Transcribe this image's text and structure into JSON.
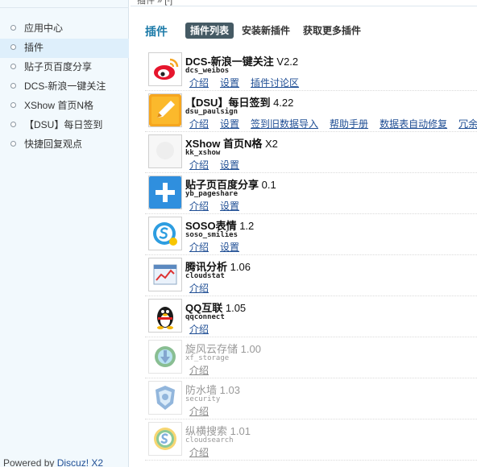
{
  "breadcrumb": "插件 » [-]",
  "sidebar": {
    "items": [
      {
        "label": "应用中心"
      },
      {
        "label": "插件"
      },
      {
        "label": "贴子页百度分享"
      },
      {
        "label": "DCS-新浪一键关注"
      },
      {
        "label": "XShow 首页N格"
      },
      {
        "label": "【DSU】每日签到"
      },
      {
        "label": "快捷回复观点"
      }
    ],
    "active_index": 1,
    "powered_prefix": "Powered by ",
    "powered_brand": "Discuz! X2"
  },
  "header": {
    "title": "插件",
    "tabs": [
      {
        "label": "插件列表",
        "current": true
      },
      {
        "label": "安装新插件",
        "current": false
      },
      {
        "label": "获取更多插件",
        "current": false
      }
    ]
  },
  "plugins": [
    {
      "name": "DCS-新浪一键关注",
      "version": "V2.2",
      "id": "dcs_weibos",
      "icon": "weibo-icon",
      "enabled": true,
      "actions": [
        "介绍",
        "设置",
        "插件讨论区"
      ]
    },
    {
      "name": "【DSU】每日签到",
      "version": "4.22",
      "id": "dsu_paulsign",
      "icon": "pencil-icon",
      "enabled": true,
      "actions": [
        "介绍",
        "设置",
        "签到旧数据导入",
        "帮助手册",
        "数据表自动修复",
        "冗余"
      ]
    },
    {
      "name": "XShow 首页N格",
      "version": "X2",
      "id": "kk_xshow",
      "icon": "blank-icon",
      "enabled": true,
      "actions": [
        "介绍",
        "设置"
      ]
    },
    {
      "name": "贴子页百度分享",
      "version": "0.1",
      "id": "yb_pageshare",
      "icon": "share-plus-icon",
      "enabled": true,
      "actions": [
        "介绍",
        "设置"
      ]
    },
    {
      "name": "SOSO表情",
      "version": "1.2",
      "id": "soso_smilies",
      "icon": "soso-smiley-icon",
      "enabled": true,
      "actions": [
        "介绍",
        "设置"
      ]
    },
    {
      "name": "腾讯分析",
      "version": "1.06",
      "id": "cloudstat",
      "icon": "analytics-chart-icon",
      "enabled": true,
      "actions": [
        "介绍"
      ]
    },
    {
      "name": "QQ互联",
      "version": "1.05",
      "id": "qqconnect",
      "icon": "qq-penguin-icon",
      "enabled": true,
      "actions": [
        "介绍"
      ]
    },
    {
      "name": "旋风云存储",
      "version": "1.00",
      "id": "xf_storage",
      "icon": "cloud-download-icon",
      "enabled": false,
      "actions": [
        "介绍"
      ]
    },
    {
      "name": "防水墙",
      "version": "1.03",
      "id": "security",
      "icon": "security-shield-icon",
      "enabled": false,
      "actions": [
        "介绍"
      ]
    },
    {
      "name": "纵横搜索",
      "version": "1.01",
      "id": "cloudsearch",
      "icon": "search-s-icon",
      "enabled": false,
      "actions": [
        "介绍"
      ]
    }
  ],
  "colors": {
    "sidebar_bg": "#f2f9fd",
    "active_item_bg": "#deeffb",
    "section_title": "#1b7aa8",
    "tab_current_bg": "#455a64",
    "link": "#1f4e94"
  }
}
